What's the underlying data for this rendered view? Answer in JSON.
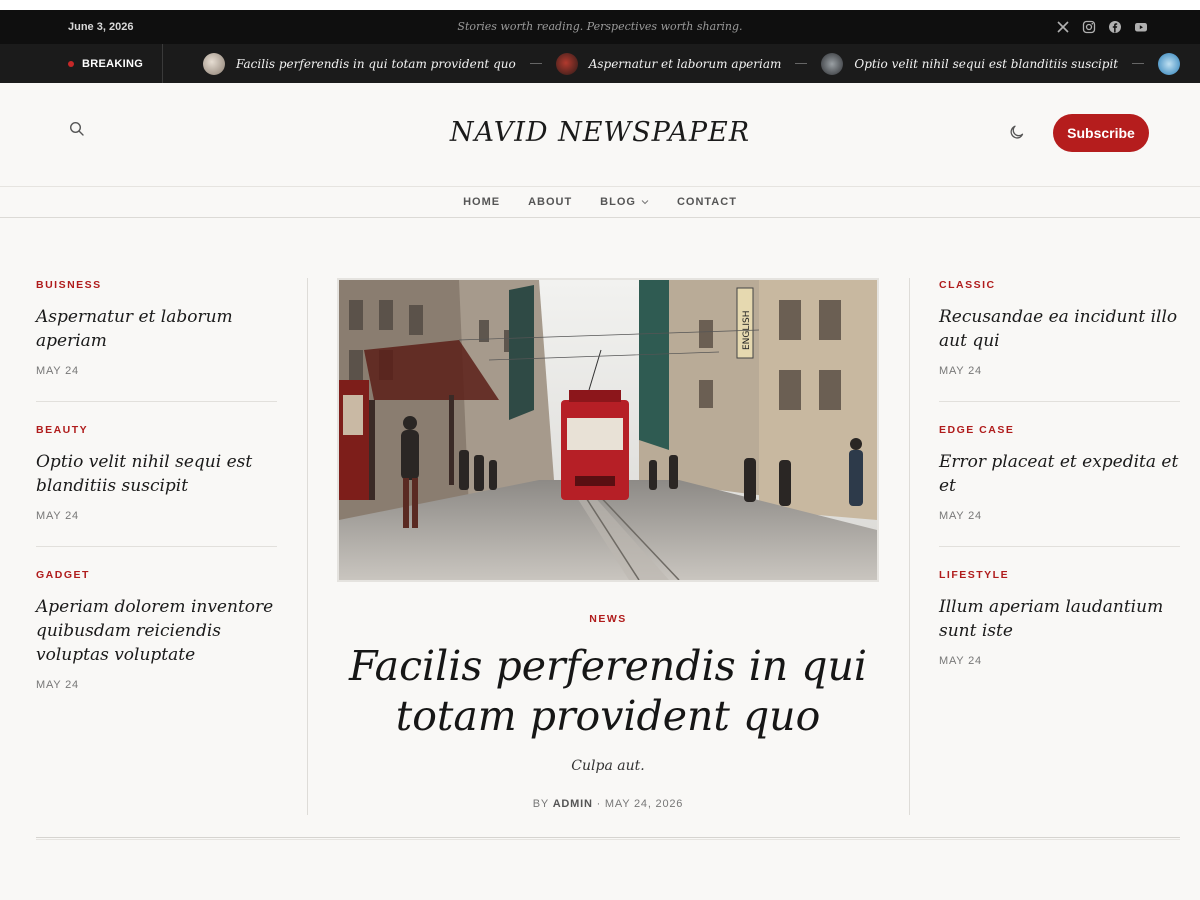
{
  "topbar": {
    "date": "June 3, 2026",
    "tagline": "Stories worth reading. Perspectives worth sharing.",
    "social_icons": [
      "x-icon",
      "instagram-icon",
      "facebook-icon",
      "youtube-icon"
    ]
  },
  "breaking": {
    "label": "BREAKING",
    "items": [
      {
        "title": "Facilis perferendis in qui totam provident quo"
      },
      {
        "title": "Aspernatur et laborum aperiam"
      },
      {
        "title": "Optio velit nihil sequi est blanditiis suscipit"
      },
      {
        "title": ""
      }
    ]
  },
  "header": {
    "logo": "NAVID NEWSPAPER",
    "subscribe_label": "Subscribe"
  },
  "nav": {
    "items": [
      "HOME",
      "ABOUT",
      "BLOG",
      "CONTACT"
    ]
  },
  "left_posts": [
    {
      "category": "BUISNESS",
      "title": "Aspernatur et laborum aperiam",
      "date": "MAY 24"
    },
    {
      "category": "BEAUTY",
      "title": "Optio velit nihil sequi est blanditiis suscipit",
      "date": "MAY 24"
    },
    {
      "category": "GADGET",
      "title": "Aperiam dolorem inventore quibusdam reiciendis voluptas voluptate",
      "date": "MAY 24"
    }
  ],
  "featured": {
    "category": "NEWS",
    "title": "Facilis perferendis in qui totam provident quo",
    "excerpt": "Culpa aut.",
    "by": "BY",
    "author": "ADMIN",
    "date": "· MAY 24, 2026",
    "image_sign": "ENGLISH"
  },
  "right_posts": [
    {
      "category": "CLASSIC",
      "title": "Recusandae ea incidunt illo aut qui",
      "date": "MAY 24"
    },
    {
      "category": "EDGE CASE",
      "title": "Error placeat et expedita et et",
      "date": "MAY 24"
    },
    {
      "category": "LIFESTYLE",
      "title": "Illum aperiam laudantium sunt iste",
      "date": "MAY 24"
    }
  ],
  "colors": {
    "accent": "#b51d1d",
    "topbar": "#0f0f0f",
    "background": "#f9f8f6"
  }
}
